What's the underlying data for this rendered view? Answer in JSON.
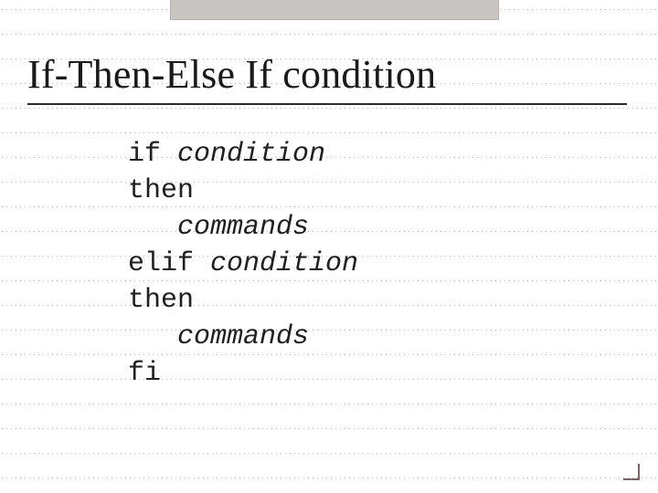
{
  "slide": {
    "title": "If-Then-Else If condition",
    "code": {
      "l1a": "if ",
      "l1b": "condition",
      "l2": "then",
      "l3": "   commands",
      "l4a": "elif ",
      "l4b": "condition",
      "l5": "then",
      "l6": "   commands",
      "l7": "fi"
    }
  }
}
